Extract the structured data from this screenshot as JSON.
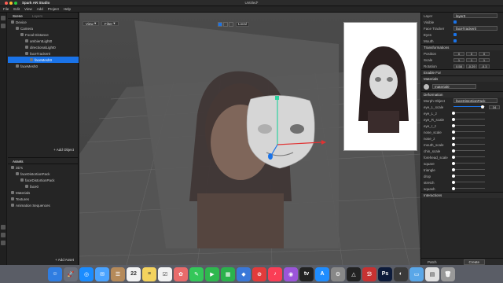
{
  "mac": {
    "app_name": "Spark AR Studio",
    "window_title": "Untitled*"
  },
  "menu": [
    "File",
    "Edit",
    "View",
    "Add",
    "Project",
    "Help"
  ],
  "scene": {
    "tabs": [
      "Scene",
      "Layers"
    ],
    "items": [
      {
        "label": "Device",
        "indent": 0
      },
      {
        "label": "Camera",
        "indent": 1
      },
      {
        "label": "Focal Distance",
        "indent": 2
      },
      {
        "label": "ambientLight0",
        "indent": 3
      },
      {
        "label": "directionalLight0",
        "indent": 3
      },
      {
        "label": "faceTracker0",
        "indent": 3
      },
      {
        "label": "faceMesh0",
        "indent": 4,
        "selected": true
      },
      {
        "label": "faceMesh0",
        "indent": 1
      }
    ],
    "add_object": "+ Add Object"
  },
  "assets": {
    "title": "Assets",
    "items": [
      {
        "label": "3D's",
        "indent": 0
      },
      {
        "label": "faceDistortionPack",
        "indent": 1
      },
      {
        "label": "faceDistortionPack",
        "indent": 2
      },
      {
        "label": "face0",
        "indent": 3
      },
      {
        "label": "Materials",
        "indent": 0
      },
      {
        "label": "Textures",
        "indent": 0
      },
      {
        "label": "Animation Sequences",
        "indent": 0
      }
    ],
    "add_asset": "+ Add Asset"
  },
  "viewport": {
    "view_btn": "View",
    "filter_btn": "Filter",
    "local_label": "Local"
  },
  "inspector": {
    "layer": {
      "label": "Layer",
      "value": "layer0"
    },
    "visible": {
      "label": "Visible"
    },
    "face_tracker": {
      "label": "Face Tracker",
      "value": "faceTracker0"
    },
    "eyes": {
      "label": "Eyes"
    },
    "mouth": {
      "label": "Mouth"
    },
    "transformations": "Transformations",
    "position": {
      "label": "Position",
      "values": [
        "0",
        "0",
        "0"
      ]
    },
    "scale": {
      "label": "Scale",
      "values": [
        "1",
        "1",
        "1"
      ]
    },
    "rotation": {
      "label": "Rotation",
      "values": [
        "0.58",
        "-0.29",
        "-0.3"
      ]
    },
    "enable_for": "Enable For",
    "materials": "Materials",
    "material_value": "material0",
    "deformation": "Deformation",
    "morph_object": {
      "label": "Morph Object",
      "value": "faceDistortionPack"
    },
    "sliders": [
      {
        "label": "eye_L_scale",
        "value": 0.92,
        "text": "34"
      },
      {
        "label": "eye_L_z",
        "value": 0.0
      },
      {
        "label": "eye_R_scale",
        "value": 0.0
      },
      {
        "label": "eye_r_z",
        "value": 0.0
      },
      {
        "label": "nose_scale",
        "value": 0.0
      },
      {
        "label": "nose_z",
        "value": 0.0
      },
      {
        "label": "mouth_scale",
        "value": 0.0
      },
      {
        "label": "chin_scale",
        "value": 0.0
      },
      {
        "label": "forehead_scale",
        "value": 0.0
      },
      {
        "label": "square",
        "value": 0.0
      },
      {
        "label": "triangle",
        "value": 0.0
      },
      {
        "label": "drop",
        "value": 0.0
      },
      {
        "label": "stretch",
        "value": 0.0
      },
      {
        "label": "squash",
        "value": 0.0
      }
    ],
    "interactions": "Interactions",
    "footer_left": "Patch",
    "footer_btn": "Create"
  },
  "dock": {
    "items": [
      {
        "name": "finder-icon",
        "label": "☺",
        "color": "#2f7de1"
      },
      {
        "name": "launchpad-icon",
        "label": "🚀",
        "color": "#6b6f7a"
      },
      {
        "name": "safari-icon",
        "label": "◎",
        "color": "#1a8cff"
      },
      {
        "name": "mail-icon",
        "label": "✉",
        "color": "#4aa3ff"
      },
      {
        "name": "contacts-icon",
        "label": "☰",
        "color": "#b58a5a"
      },
      {
        "name": "calendar-icon",
        "label": "22",
        "color": "#f2f2f2"
      },
      {
        "name": "notes-icon",
        "label": "≡",
        "color": "#f4d35e"
      },
      {
        "name": "reminders-icon",
        "label": "☑",
        "color": "#f2f2f2"
      },
      {
        "name": "photos-icon",
        "label": "✿",
        "color": "#e86b6b"
      },
      {
        "name": "messages-icon",
        "label": "✎",
        "color": "#34c759"
      },
      {
        "name": "facetime-icon",
        "label": "▶",
        "color": "#2fb84e"
      },
      {
        "name": "numbers-icon",
        "label": "▦",
        "color": "#2bb24c"
      },
      {
        "name": "keynote-icon",
        "label": "◆",
        "color": "#3a78d8"
      },
      {
        "name": "news-icon",
        "label": "⊘",
        "color": "#e23b3b"
      },
      {
        "name": "music-icon",
        "label": "♪",
        "color": "#fa3e56"
      },
      {
        "name": "podcasts-icon",
        "label": "◉",
        "color": "#9b55d9"
      },
      {
        "name": "tv-icon",
        "label": "tv",
        "color": "#222"
      },
      {
        "name": "appstore-icon",
        "label": "A",
        "color": "#1f8dff"
      },
      {
        "name": "preferences-icon",
        "label": "⚙",
        "color": "#888"
      },
      {
        "name": "spark-icon",
        "label": "△",
        "color": "#222"
      },
      {
        "name": "bear-icon",
        "label": "ℬ",
        "color": "#c73232"
      },
      {
        "name": "photoshop-icon",
        "label": "Ps",
        "color": "#0d1b3a"
      },
      {
        "name": "browser-icon",
        "label": "◐",
        "color": "#3a3a3a"
      },
      {
        "name": "folder-icon",
        "label": "▭",
        "color": "#5aa7e8"
      },
      {
        "name": "files-icon",
        "label": "▤",
        "color": "#e0e0e0"
      },
      {
        "name": "trash-icon",
        "label": "🗑",
        "color": "#999"
      }
    ]
  }
}
